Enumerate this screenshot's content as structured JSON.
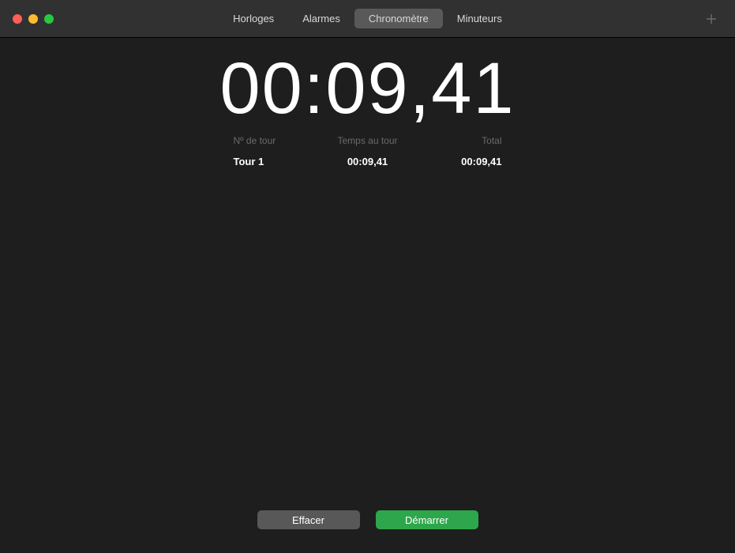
{
  "titlebar": {
    "tabs": [
      {
        "label": "Horloges",
        "active": false
      },
      {
        "label": "Alarmes",
        "active": false
      },
      {
        "label": "Chronomètre",
        "active": true
      },
      {
        "label": "Minuteurs",
        "active": false
      }
    ]
  },
  "stopwatch": {
    "time": "00:09,41",
    "headers": {
      "lap": "Nº de tour",
      "laptime": "Temps au tour",
      "total": "Total"
    },
    "laps": [
      {
        "name": "Tour 1",
        "laptime": "00:09,41",
        "total": "00:09,41"
      }
    ]
  },
  "buttons": {
    "clear": "Effacer",
    "start": "Démarrer"
  }
}
